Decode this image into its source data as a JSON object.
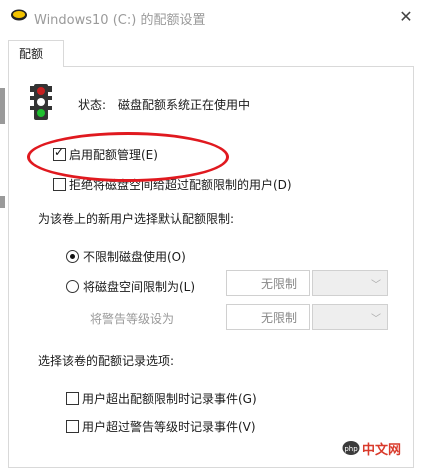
{
  "window": {
    "title": "Windows10 (C:) 的配额设置",
    "close_glyph": "✕"
  },
  "tabs": [
    {
      "label": "配额",
      "selected": true
    }
  ],
  "status": {
    "label": "状态:",
    "value": "磁盘配额系统正在使用中",
    "icon": "traffic-light-icon"
  },
  "options": {
    "enable_quota": {
      "label": "启用配额管理(E)",
      "checked": true
    },
    "deny_space": {
      "label": "拒绝将磁盘空间给超过配额限制的用户(D)",
      "checked": false
    }
  },
  "default_limit": {
    "heading": "为该卷上的新用户选择默认配额限制:",
    "no_limit": {
      "label": "不限制磁盘使用(O)",
      "selected": true
    },
    "limit_to": {
      "label": "将磁盘空间限制为(L)",
      "selected": false,
      "value": "无限制"
    },
    "warning_level": {
      "label": "将警告等级设为",
      "value": "无限制"
    }
  },
  "logging": {
    "heading": "选择该卷的配额记录选项:",
    "log_exceed_limit": {
      "label": "用户超出配额限制时记录事件(G)",
      "checked": false
    },
    "log_exceed_warning": {
      "label": "用户超过警告等级时记录事件(V)",
      "checked": false
    }
  },
  "annotation": {
    "color": "#e0191f"
  },
  "watermark": {
    "text": "中文网",
    "logo": "php"
  }
}
